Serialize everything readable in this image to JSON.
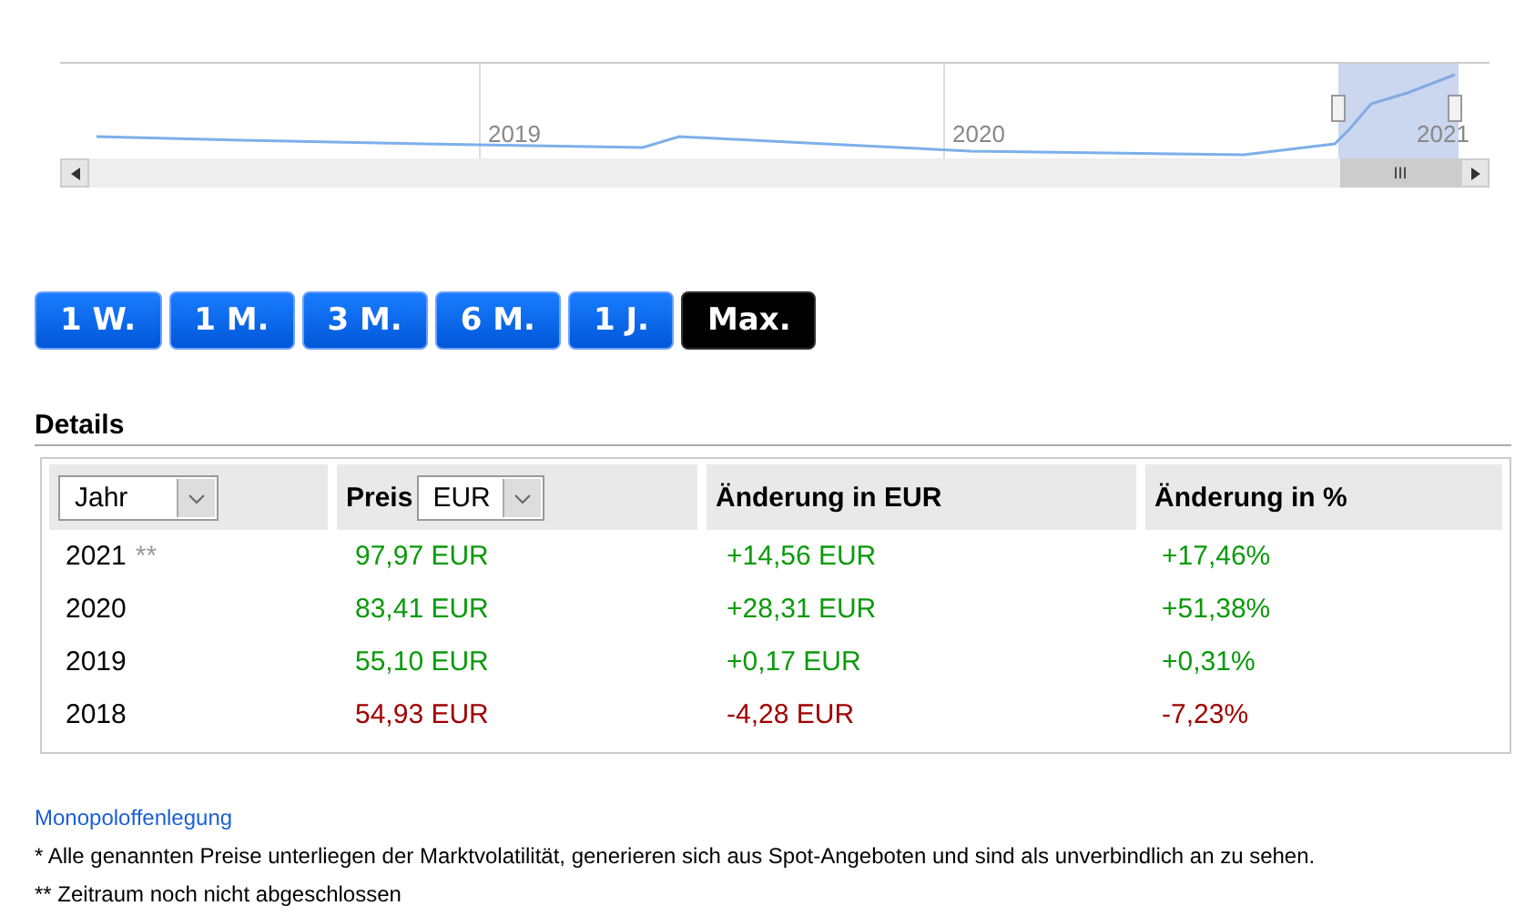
{
  "navigator": {
    "year_labels": [
      "2019",
      "2020",
      "2021"
    ],
    "scroll_grip": "III"
  },
  "range_buttons": [
    {
      "label": "1 W.",
      "selected": false
    },
    {
      "label": "1 M.",
      "selected": false
    },
    {
      "label": "3 M.",
      "selected": false
    },
    {
      "label": "6 M.",
      "selected": false
    },
    {
      "label": "1 J.",
      "selected": false
    },
    {
      "label": "Max.",
      "selected": true
    }
  ],
  "details": {
    "title": "Details",
    "period_select": "Jahr",
    "price_label": "Preis",
    "currency_select": "EUR",
    "columns": [
      "Änderung in EUR",
      "Änderung in %"
    ],
    "rows": [
      {
        "year": "2021",
        "note": "**",
        "price": "97,97 EUR",
        "change": "+14,56 EUR",
        "percent": "+17,46%",
        "kind": "gain"
      },
      {
        "year": "2020",
        "price": "83,41 EUR",
        "change": "+28,31 EUR",
        "percent": "+51,38%",
        "kind": "gain"
      },
      {
        "year": "2019",
        "price": "55,10 EUR",
        "change": "+0,17 EUR",
        "percent": "+0,31%",
        "kind": "gain"
      },
      {
        "year": "2018",
        "price": "54,93 EUR",
        "change": "-4,28 EUR",
        "percent": "-7,23%",
        "kind": "loss"
      }
    ]
  },
  "footer": {
    "link": "Monopoloffenlegung",
    "notes": [
      "* Alle genannten Preise unterliegen der Marktvolatilität, generieren sich aus Spot-Angeboten und sind als unverbindlich an zu sehen.",
      "** Zeitraum noch nicht abgeschlossen"
    ]
  }
}
